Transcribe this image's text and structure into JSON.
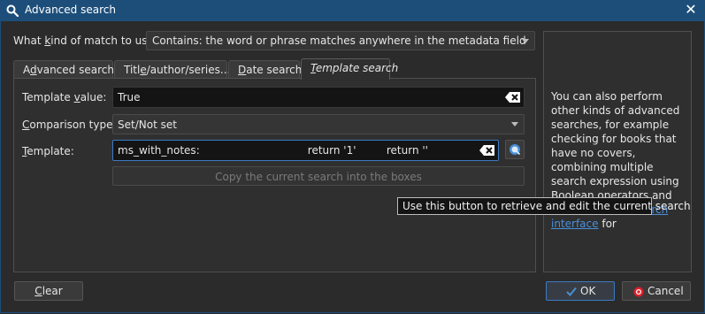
{
  "window": {
    "title": "Advanced search",
    "close_glyph": "✕",
    "icon": "magnifier-icon"
  },
  "match": {
    "label": "What kind of match to use:",
    "selected": "Contains: the word or phrase matches anywhere in the metadata field"
  },
  "tabs": [
    {
      "label": "Advanced search",
      "active": false
    },
    {
      "label": "Title/author/series...",
      "active": false
    },
    {
      "label": "Date search",
      "active": false
    },
    {
      "label": "Template search",
      "active": true
    }
  ],
  "template_tab": {
    "template_value_label": "Template value:",
    "template_value": "True",
    "comparison_type_label": "Comparison type:",
    "comparison_type": "Set/Not set",
    "template_label": "Template:",
    "template_text": "ms_with_notes:                                return '1'         return ''",
    "copy_button": "Copy the current search into the boxes"
  },
  "tooltip": "Use this button to retrieve and edit the current search",
  "side_panel": {
    "text_before_link": "You can also perform other kinds of advanced searches, for example checking for books that have no covers, combining multiple search expression using Boolean operators and so on. See",
    "link": "The search interface",
    "text_after_link": "for"
  },
  "buttons": {
    "clear": "Clear",
    "ok": "OK",
    "cancel": "Cancel"
  },
  "colors": {
    "accent": "#3d7ac4",
    "titlebar": "#1d4e7a",
    "link": "#4a90d9",
    "cancel_icon": "#e0202a",
    "ok_icon": "#4a8fd6"
  }
}
